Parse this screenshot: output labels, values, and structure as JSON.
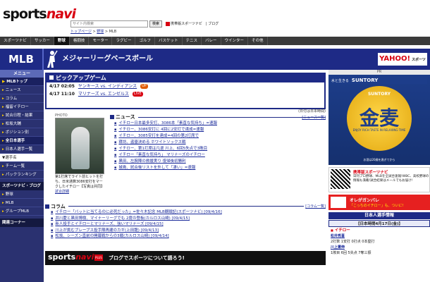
{
  "header": {
    "logo_main": "sports",
    "logo_accent": "navi",
    "search_placeholder": "サイト内検索",
    "search_button": "検索",
    "mobile_link": "携帯版スポーツナビ",
    "blog_link": "ブログ",
    "breadcrumb_top": "トップページ",
    "breadcrumb_mid": "野球",
    "breadcrumb_sep": " > ",
    "breadcrumb_current": "MLB"
  },
  "nav": {
    "items": [
      "スポーツナビ",
      "サッカー",
      "野球",
      "格闘技",
      "モーター",
      "ラグビー",
      "ゴルフ",
      "バスケット",
      "テニス",
      "バレー",
      "ウインター",
      "その他"
    ]
  },
  "band": {
    "section": "MLB",
    "title": "メジャーリーグベースボール",
    "yahoo": "YAHOO!",
    "yahoo_sub": "スポーツ"
  },
  "sidebar": {
    "menu_head": "メニュー",
    "items": [
      "MLBトップ",
      "ニュース",
      "コラム",
      "福留イチロー",
      "試合日程・結果",
      "松坂大輔",
      "ポジション別",
      "全日本選手",
      "日本人選手一覧",
      "チーム一覧",
      "パックランキング"
    ],
    "select_label": "▼選手名",
    "section_title": "スポーツナビ・ブログ",
    "blog_items": [
      "野球",
      "MLB",
      "グループMLB"
    ],
    "bottom_section": "関連コーナー"
  },
  "pickup": {
    "title": "ピックアップゲーム",
    "games": [
      {
        "date": "4/17 02:05",
        "match": "ヤンキース vs. インディアンス",
        "status": "UP"
      },
      {
        "date": "4/17 11:10",
        "match": "マリナーズ vs. エンゼルス",
        "status": "LIVE"
      }
    ]
  },
  "photo": {
    "label": "PHOTO",
    "caption": "第1打席でライト前ヒットを打ち、日米通算3086安打をマークしたイチロー【写真は共同】",
    "caption_link": "試合詳細"
  },
  "news": {
    "title": "ニュース",
    "date": "(日付は日本時間)",
    "more": "[ニュース一覧]",
    "items": [
      "イチロー日本最多安打、3086本「素直な気持ち」=速報",
      "イチロー、3086安打に 4回に2安打で達成=速報",
      "イチロー、3085安打を達成=4回の第2打席で",
      "寝坊、盗塁決める ホワイトソックス戦",
      "イチロー、第1打席は凡退 川上、6回5失点で3敗目",
      "イチロー「素直な気持ち」 マリナーズのイチロー",
      "黒田、左腕陣の救援実り 復帰後初勝利",
      "城島、試合後リストを外して「凄い」=速報"
    ]
  },
  "column": {
    "title": "コラム",
    "more": "[コラム一覧]",
    "items": [
      "イチロー「バットに当てるのに必死だった」=佐々木記念 MLB観戦記(スポーツナビ) [09/4/16]",
      "井川慶と黒田博樹、マイナーリーグでも 2度の登板(カルロス山崎) [09/4/15]",
      "新人投手とイチローとマリナーズ、強いマリナーズ [09/4/15]",
      "川上が挑むブレーブス投手陣再建のカギ(上田龍) [09/4/13]",
      "松坂、シーズン直前の開幕戦からの3戦(カルロス山崎) [09/4/14]"
    ]
  },
  "blog_banner": {
    "main": "sports",
    "accent": "navi",
    "plus": "PLUS",
    "tagline": "ブログでスポーツについて語ろう!"
  },
  "right": {
    "pr": "PR",
    "suntory_head": "水と生きる",
    "suntory_brand": "SUNTORY",
    "suntory_kanji": "金麦",
    "suntory_sub": "ENJOY RICH TASTE IN RELAXING TIME",
    "suntory_bottom": "お酒は20歳を過ぎてから",
    "mobile_title": "携帯版スポーツナビ",
    "mobile_desc": "日刊プロ野球、MLBを全試合速報!WBC、高校野球の情報も満載!試合結果はメールでもお届け!",
    "ganbare_1": "オレがガンバレ",
    "ganbare_2": "「こっちのイチロー」も、ついに!",
    "jp_head": "日本人選手情報",
    "jp_date": "【日本時間4月17日(金)】",
    "jp_sec1": "イチロー",
    "jp_name1": "松井秀喜",
    "jp_row1": "2打数 1安打 0打点 0本塁打",
    "jp_name2": "川上憲伸",
    "jp_row2": "1敗目 6回 5失点 7奪三振"
  }
}
